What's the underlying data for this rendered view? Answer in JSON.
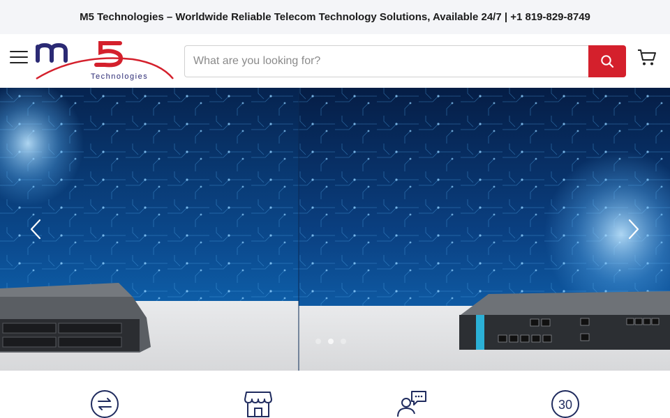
{
  "announcement": "M5 Technologies – Worldwide Reliable Telecom Technology Solutions, Available 24/7 | +1 819-829-8749",
  "header": {
    "logo_text": "m5",
    "logo_subtext": "Technologies",
    "search_placeholder": "What are you looking for?",
    "icons": {
      "menu": "hamburger-icon",
      "search": "search-icon",
      "cart": "cart-icon"
    }
  },
  "hero": {
    "slide_count": 3,
    "active_slide": 2,
    "icons": {
      "prev": "chevron-left-icon",
      "next": "chevron-right-icon"
    }
  },
  "features": {
    "icons": [
      "exchange-arrows-icon",
      "storefront-icon",
      "support-chat-icon",
      "thirty-days-icon"
    ],
    "thirty_label": "30"
  },
  "colors": {
    "brand_red": "#d4202c",
    "brand_navy": "#2b2a74",
    "hero_blue": "#0b3a78",
    "feature_navy": "#1f2b5e"
  }
}
